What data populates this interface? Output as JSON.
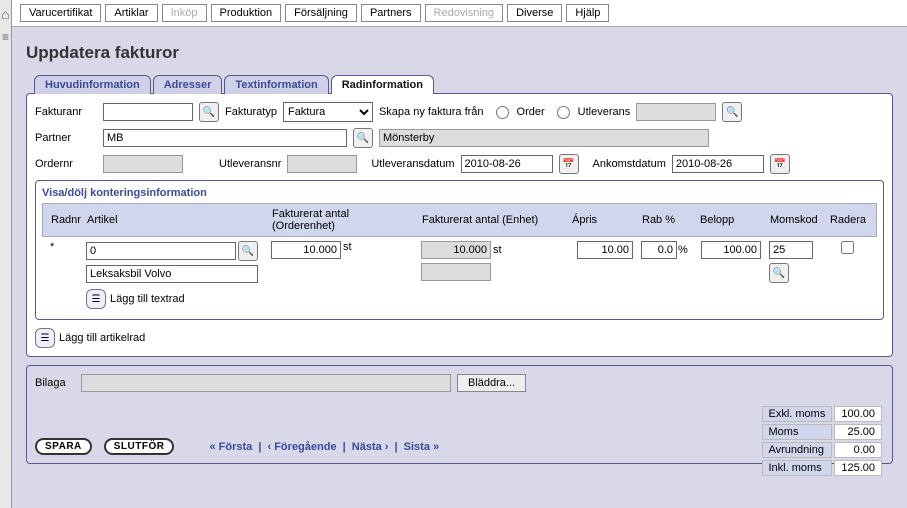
{
  "top_menu": {
    "items": [
      "Varucertifikat",
      "Artiklar",
      "Inköp",
      "Produktion",
      "Försäljning",
      "Partners",
      "Redovisning",
      "Diverse",
      "Hjälp"
    ],
    "disabled": [
      2,
      6
    ]
  },
  "page_title": "Uppdatera fakturor",
  "tabs": {
    "items": [
      "Huvudinformation",
      "Adresser",
      "Textinformation",
      "Radinformation"
    ],
    "active": 3
  },
  "form": {
    "fakturanr_label": "Fakturanr",
    "fakturanr_value": "",
    "fakturatyp_label": "Fakturatyp",
    "fakturatyp_value": "Faktura",
    "skapa_label": "Skapa ny faktura från",
    "order_label": "Order",
    "utleverans_label": "Utleverans",
    "partner_label": "Partner",
    "partner_code": "MB",
    "partner_name": "Mönsterby",
    "ordernr_label": "Ordernr",
    "ordernr_value": "",
    "utleveransnr_label": "Utleveransnr",
    "utleveransnr_value": "",
    "utleveransdatum_label": "Utleveransdatum",
    "utleveransdatum_value": "2010-08-26",
    "ankomstdatum_label": "Ankomstdatum",
    "ankomstdatum_value": "2010-08-26"
  },
  "grid": {
    "toggle_label": "Visa/dölj konteringsinformation",
    "headers": {
      "radnr": "Radnr",
      "artikel": "Artikel",
      "order": "Fakturerat antal (Orderenhet)",
      "enhet": "Fakturerat antal (Enhet)",
      "apris": "Ápris",
      "rab": "Rab %",
      "belopp": "Belopp",
      "moms": "Momskod",
      "radera": "Radera"
    },
    "row": {
      "radnr": "*",
      "artikel_code": "0",
      "artikel_name": "Leksaksbil Volvo",
      "order_qty": "10.000",
      "order_unit": "st",
      "enhet_qty": "10.000",
      "enhet_unit": "st",
      "apris": "10.00",
      "rab": "0.0",
      "rab_unit": "%",
      "belopp": "100.00",
      "moms": "25"
    },
    "add_textrad": "Lägg till textrad",
    "add_artikelrad": "Lägg till artikelrad"
  },
  "bottom": {
    "bilaga_label": "Bilaga",
    "browse_label": "Bläddra...",
    "spara": "SPARA",
    "slutfor": "SLUTFÖR",
    "nav": {
      "first": "« Första",
      "prev": "‹ Föregående",
      "next": "Nästa ›",
      "last": "Sista »"
    },
    "totals": {
      "exkl_label": "Exkl. moms",
      "exkl_val": "100.00",
      "moms_label": "Moms",
      "moms_val": "25.00",
      "avrund_label": "Avrundning",
      "avrund_val": "0.00",
      "inkl_label": "Inkl. moms",
      "inkl_val": "125.00"
    }
  }
}
